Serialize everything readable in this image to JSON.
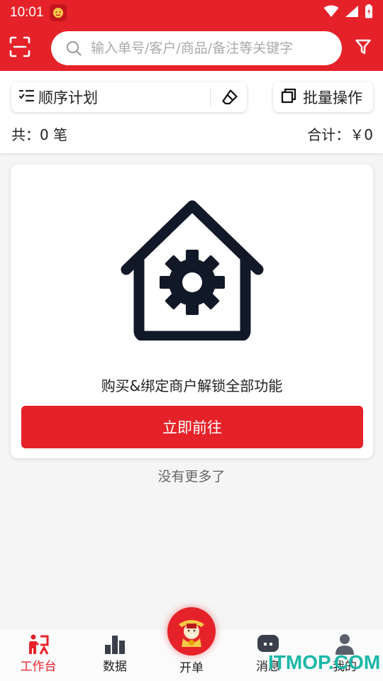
{
  "status_bar": {
    "time": "10:01"
  },
  "search": {
    "placeholder": "输入单号/客户/商品/备注等关键字"
  },
  "toolbar": {
    "plan_label": "顺序计划",
    "batch_label": "批量操作",
    "count_text": "共：0 笔",
    "total_text": "合计：￥0"
  },
  "card": {
    "message": "购买&绑定商户解锁全部功能",
    "button_label": "立即前往"
  },
  "list_footer": "没有更多了",
  "bottom_nav": {
    "items": [
      {
        "label": "工作台",
        "icon": "workbench-icon",
        "active": true
      },
      {
        "label": "数据",
        "icon": "bar-chart-icon",
        "active": false
      },
      {
        "label": "开单",
        "icon": "mascot-icon",
        "active": false
      },
      {
        "label": "消息",
        "icon": "message-icon",
        "active": false
      },
      {
        "label": "我的",
        "icon": "user-icon",
        "active": false
      }
    ]
  },
  "watermark": "ITMOP.COM",
  "colors": {
    "brand_red": "#e5222a",
    "icon_dark": "#111827"
  }
}
